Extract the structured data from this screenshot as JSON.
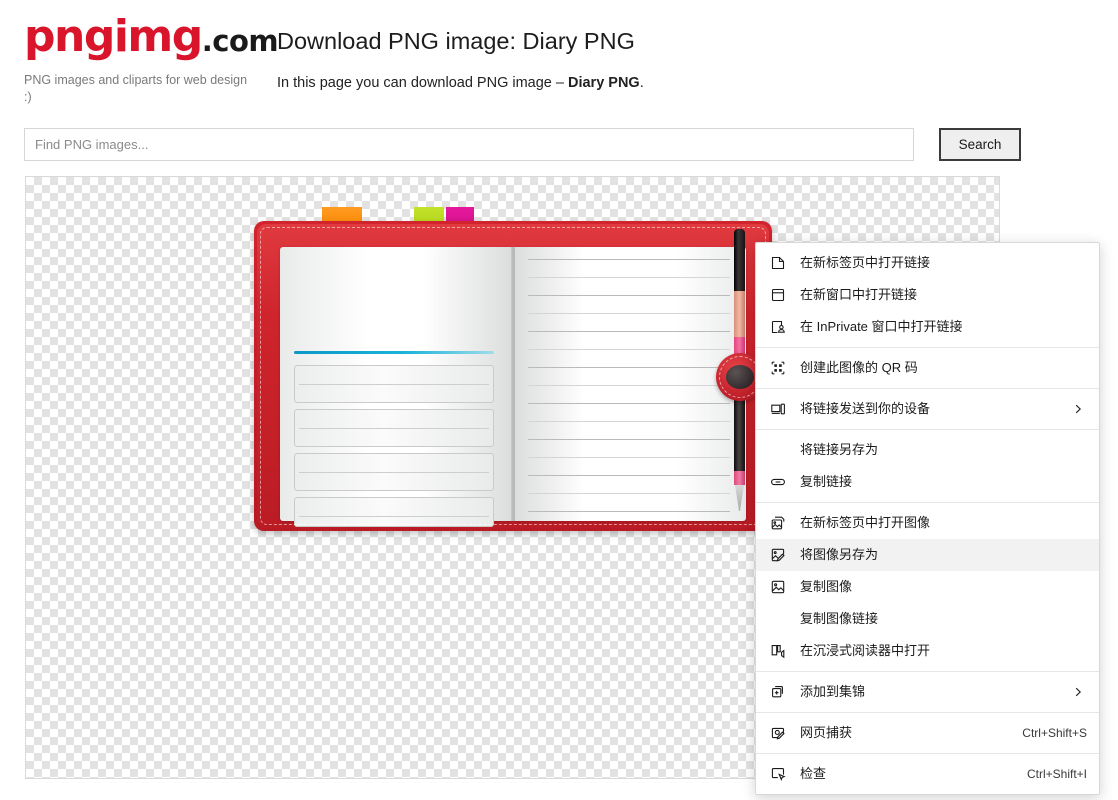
{
  "site": {
    "logo_main": "pngimg",
    "logo_suffix": ".com",
    "tagline": "PNG images and cliparts for web design :)"
  },
  "header": {
    "title": "Download PNG image: Diary PNG",
    "subtitle_prefix": "In this page you can download PNG image – ",
    "subtitle_strong": "Diary PNG",
    "subtitle_suffix": "."
  },
  "search": {
    "placeholder": "Find PNG images...",
    "value": "",
    "button_label": "Search"
  },
  "image_preview": {
    "alt": "Diary PNG",
    "description": "Open red leather diary with blank ruled pages, colored bookmark tabs and a fountain pen",
    "bookmark_colors": [
      "#f98500",
      "#aed116",
      "#cf1189"
    ],
    "cover_color": "#c31f27",
    "accent_rule_color": "#1bb4d8",
    "background": "transparency-checkerboard"
  },
  "context_menu": {
    "highlighted_item": "将图像另存为",
    "groups": [
      {
        "items": [
          {
            "icon": "open-in-new-tab-icon",
            "label": "在新标签页中打开链接",
            "accel": "",
            "submenu": false
          },
          {
            "icon": "open-in-new-window-icon",
            "label": "在新窗口中打开链接",
            "accel": "",
            "submenu": false
          },
          {
            "icon": "inprivate-window-icon",
            "label": "在 InPrivate 窗口中打开链接",
            "accel": "",
            "submenu": false
          }
        ]
      },
      {
        "items": [
          {
            "icon": "qr-code-icon",
            "label": "创建此图像的 QR 码",
            "accel": "",
            "submenu": false
          }
        ]
      },
      {
        "items": [
          {
            "icon": "send-to-device-icon",
            "label": "将链接发送到你的设备",
            "accel": "",
            "submenu": true
          }
        ]
      },
      {
        "items": [
          {
            "icon": "none",
            "label": "将链接另存为",
            "accel": "",
            "submenu": false
          },
          {
            "icon": "copy-link-icon",
            "label": "复制链接",
            "accel": "",
            "submenu": false
          }
        ]
      },
      {
        "items": [
          {
            "icon": "open-image-new-tab-icon",
            "label": "在新标签页中打开图像",
            "accel": "",
            "submenu": false
          },
          {
            "icon": "save-image-icon",
            "label": "将图像另存为",
            "accel": "",
            "submenu": false
          },
          {
            "icon": "copy-image-icon",
            "label": "复制图像",
            "accel": "",
            "submenu": false
          },
          {
            "icon": "none",
            "label": "复制图像链接",
            "accel": "",
            "submenu": false
          },
          {
            "icon": "immersive-reader-icon",
            "label": "在沉浸式阅读器中打开",
            "accel": "",
            "submenu": false
          }
        ]
      },
      {
        "items": [
          {
            "icon": "add-to-collections-icon",
            "label": "添加到集锦",
            "accel": "",
            "submenu": true
          }
        ]
      },
      {
        "items": [
          {
            "icon": "web-capture-icon",
            "label": "网页捕获",
            "accel": "Ctrl+Shift+S",
            "submenu": false
          }
        ]
      },
      {
        "items": [
          {
            "icon": "inspect-icon",
            "label": "检查",
            "accel": "Ctrl+Shift+I",
            "submenu": false
          }
        ]
      }
    ]
  }
}
